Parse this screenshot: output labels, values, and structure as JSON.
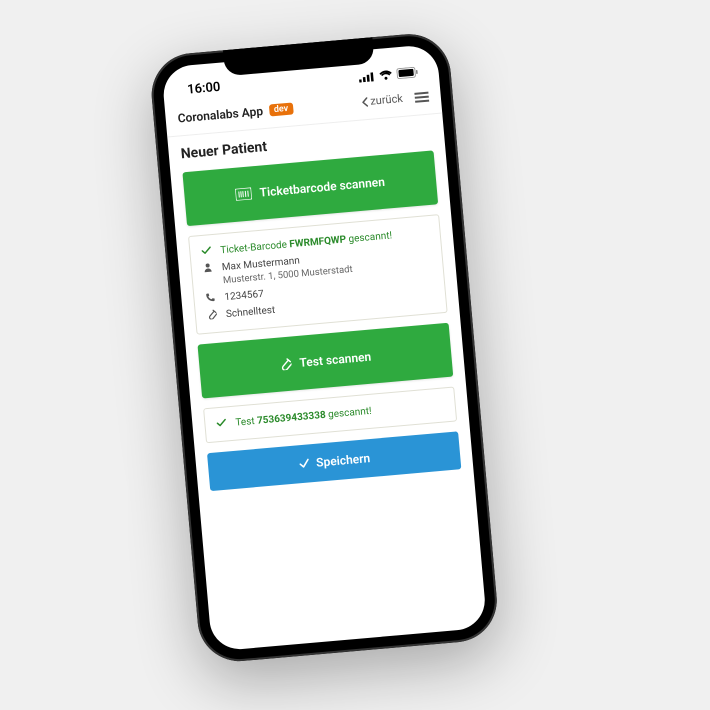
{
  "status_bar": {
    "time": "16:00"
  },
  "header": {
    "app_title": "Coronalabs App",
    "dev_label": "dev",
    "back_label": "zurück"
  },
  "page": {
    "title": "Neuer Patient",
    "scan_ticket_label": "Ticketbarcode scannen",
    "ticket_card": {
      "prefix": "Ticket-Barcode ",
      "code": "FWRMFQWP",
      "suffix": " gescannt!",
      "name": "Max Mustermann",
      "address": "Musterstr. 1, 5000 Musterstadt",
      "phone": "1234567",
      "test_type": "Schnelltest"
    },
    "scan_test_label": "Test scannen",
    "test_card": {
      "prefix": "Test ",
      "code": "753639433338",
      "suffix": " gescannt!"
    },
    "save_label": "Speichern"
  }
}
